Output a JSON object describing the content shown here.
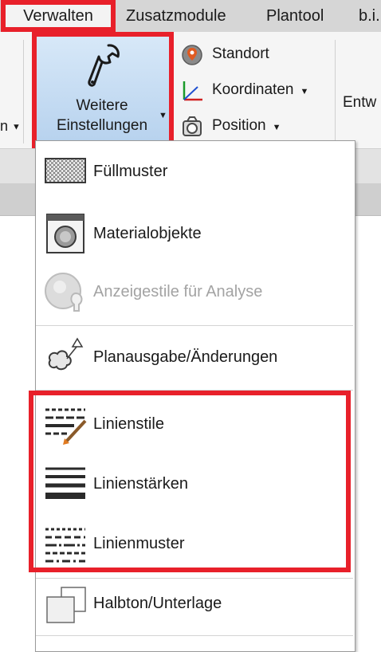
{
  "tabs": [
    {
      "label": "Verwalten",
      "active": true
    },
    {
      "label": "Zusatzmodule",
      "active": false
    },
    {
      "label": "Plantool",
      "active": false
    },
    {
      "label": "b.i.",
      "active": false
    }
  ],
  "ribbon": {
    "left_partial_label": "n",
    "big_button": {
      "line1": "Weitere",
      "line2": "Einstellungen"
    },
    "standort": "Standort",
    "koordinaten": "Koordinaten",
    "position": "Position",
    "right_partial_label": "Entw"
  },
  "menu": {
    "items": [
      {
        "label": "Füllmuster",
        "icon": "fill-pattern-icon",
        "enabled": true
      },
      {
        "label": "Materialobjekte",
        "icon": "material-objects-icon",
        "enabled": true
      },
      {
        "label": "Anzeigestile für Analyse",
        "icon": "analysis-display-styles-icon",
        "enabled": false
      },
      {
        "label": "Planausgabe/Änderungen",
        "icon": "sheet-revisions-icon",
        "enabled": true
      },
      {
        "label": "Linienstile",
        "icon": "line-styles-icon",
        "enabled": true
      },
      {
        "label": "Linienstärken",
        "icon": "line-weights-icon",
        "enabled": true
      },
      {
        "label": "Linienmuster",
        "icon": "line-patterns-icon",
        "enabled": true
      },
      {
        "label": "Halbton/Unterlage",
        "icon": "halftone-underlay-icon",
        "enabled": true
      }
    ]
  },
  "colors": {
    "highlight": "#e8202a",
    "button_active": "#c4dcf3"
  }
}
